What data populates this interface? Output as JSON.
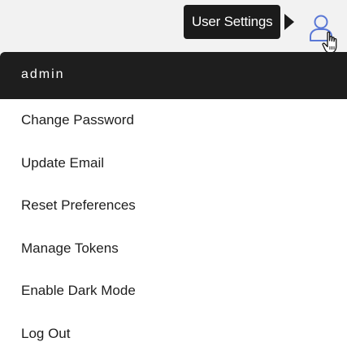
{
  "tooltip": {
    "text": "User Settings"
  },
  "user_button": {
    "icon": "user-icon",
    "color": "#5a78d6"
  },
  "menu": {
    "header": "admin",
    "items": [
      {
        "label": "Change Password"
      },
      {
        "label": "Update Email"
      },
      {
        "label": "Reset Preferences"
      },
      {
        "label": "Manage Tokens"
      },
      {
        "label": "Enable Dark Mode"
      },
      {
        "label": "Log Out"
      }
    ]
  },
  "colors": {
    "header_bg": "#1e1e1e",
    "tooltip_bg": "#1b1b1b",
    "page_bg": "#f2f2f2",
    "menu_bg": "#ffffff"
  }
}
